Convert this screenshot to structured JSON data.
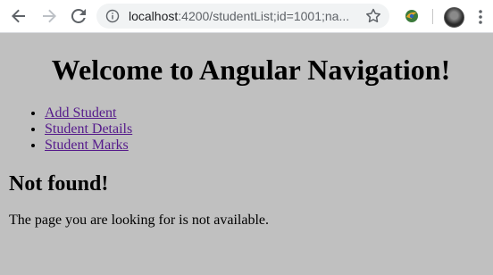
{
  "browser": {
    "url_host": "localhost",
    "url_path": ":4200/studentList;id=1001;na...",
    "icons": [
      "back-arrow-icon",
      "forward-arrow-icon",
      "reload-icon",
      "info-icon",
      "star-icon",
      "extension-icon",
      "profile-avatar",
      "menu-dots-icon"
    ]
  },
  "page": {
    "heading": "Welcome to Angular Navigation!",
    "nav_links": [
      {
        "label": "Add Student"
      },
      {
        "label": "Student Details"
      },
      {
        "label": "Student Marks"
      }
    ],
    "not_found_title": "Not found!",
    "not_found_message": "The page you are looking for is not available."
  },
  "colors": {
    "page_background": "#c0c0c0",
    "visited_link": "#551a8b"
  }
}
